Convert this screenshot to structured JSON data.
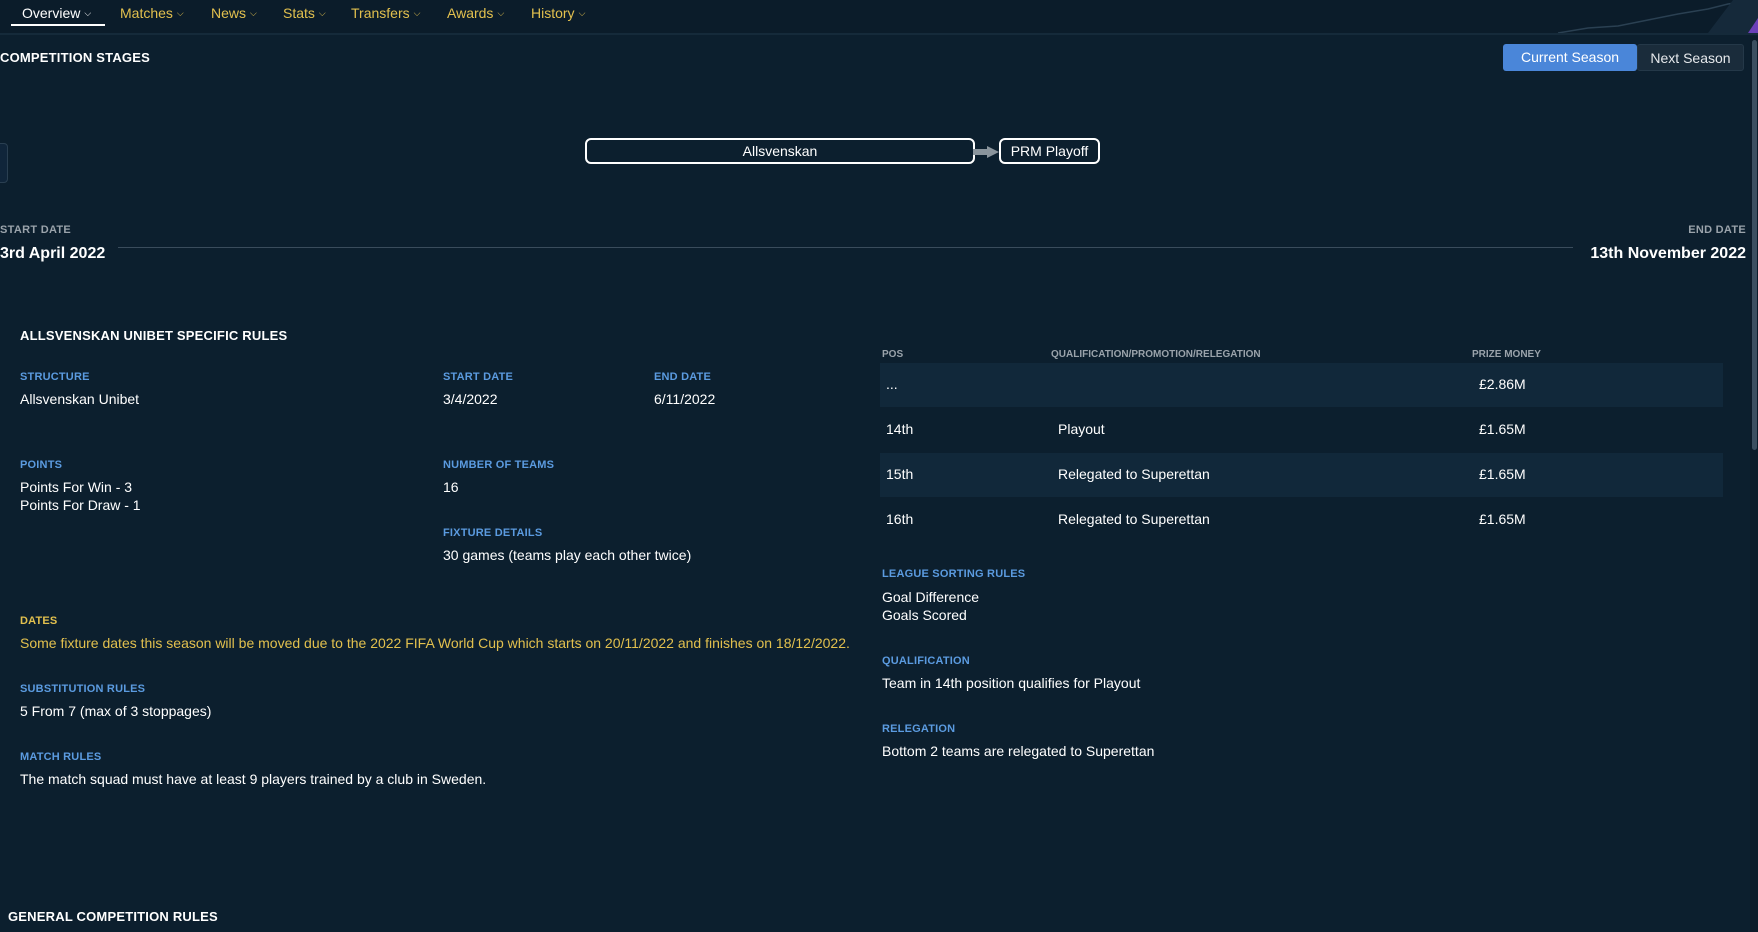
{
  "nav": {
    "items": [
      {
        "label": "Overview"
      },
      {
        "label": "Matches"
      },
      {
        "label": "News"
      },
      {
        "label": "Stats"
      },
      {
        "label": "Transfers"
      },
      {
        "label": "Awards"
      },
      {
        "label": "History"
      }
    ]
  },
  "stages": {
    "title": "COMPETITION STAGES",
    "current_season": "Current Season",
    "next_season": "Next Season",
    "stage1": "Allsvenskan",
    "stage2": "PRM Playoff",
    "start_label": "START DATE",
    "start_value": "3rd April 2022",
    "end_label": "END DATE",
    "end_value": "13th November 2022"
  },
  "rules": {
    "title": "ALLSVENSKAN UNIBET SPECIFIC RULES",
    "structure_label": "STRUCTURE",
    "structure_value": "Allsvenskan Unibet",
    "start_label": "START DATE",
    "start_value": "3/4/2022",
    "end_label": "END DATE",
    "end_value": "6/11/2022",
    "points_label": "POINTS",
    "points_win": "Points For Win - 3",
    "points_draw": "Points For Draw - 1",
    "teams_label": "NUMBER OF TEAMS",
    "teams_value": "16",
    "fixture_label": "FIXTURE DETAILS",
    "fixture_value": "30 games (teams play each other twice)",
    "dates_label": "DATES",
    "dates_value": "Some fixture dates this season will be moved due to the 2022 FIFA World Cup which starts on 20/11/2022 and finishes on 18/12/2022.",
    "subs_label": "SUBSTITUTION RULES",
    "subs_value": "5 From 7 (max of 3 stoppages)",
    "match_label": "MATCH RULES",
    "match_value": "The match squad must have at least 9 players trained by a club in Sweden."
  },
  "table": {
    "headers": {
      "pos": "POS",
      "qual": "QUALIFICATION/PROMOTION/RELEGATION",
      "prize": "PRIZE MONEY"
    },
    "rows": [
      {
        "pos": "...",
        "qual": "",
        "prize": "£2.86M"
      },
      {
        "pos": "14th",
        "qual": "Playout",
        "prize": "£1.65M"
      },
      {
        "pos": "15th",
        "qual": "Relegated to Superettan",
        "prize": "£1.65M"
      },
      {
        "pos": "16th",
        "qual": "Relegated to Superettan",
        "prize": "£1.65M"
      }
    ]
  },
  "sorting": {
    "label": "LEAGUE SORTING RULES",
    "rule1": "Goal Difference",
    "rule2": "Goals Scored"
  },
  "qualification": {
    "label": "QUALIFICATION",
    "value": "Team in 14th position qualifies for Playout"
  },
  "relegation": {
    "label": "RELEGATION",
    "value": "Bottom 2 teams are relegated to Superettan"
  },
  "general": {
    "title": "GENERAL COMPETITION RULES"
  },
  "colors": {
    "background": "#0c1f2e",
    "accent_blue": "#4a86d9",
    "label_blue": "#5b9be0",
    "nav_yellow": "#e2c04e"
  }
}
